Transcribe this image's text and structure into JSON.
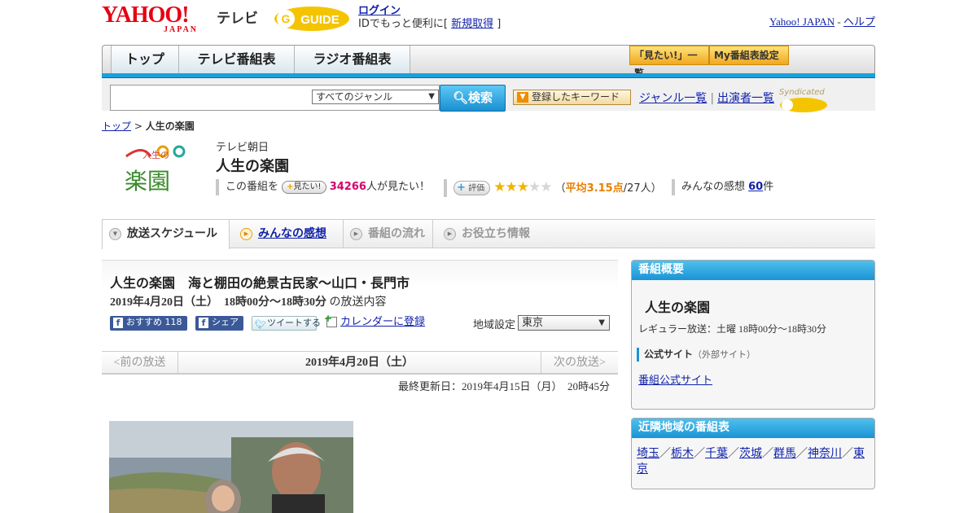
{
  "header": {
    "yahoo_logo": "YAHOO!",
    "yahoo_sub": "JAPAN",
    "tv_label": "テレビ",
    "gguide_logo": "GUIDE",
    "login_link": "ログイン",
    "login_desc_pre": "IDでもっと便利に[ ",
    "register_link": "新規取得",
    "login_desc_post": " ]",
    "yahoo_japan_link": "Yahoo! JAPAN",
    "sep": " - ",
    "help_link": "ヘルプ"
  },
  "nav": {
    "tabs": [
      "トップ",
      "テレビ番組表",
      "ラジオ番組表"
    ],
    "mitai_list": "「見たい!」一覧",
    "my_schedule": "My番組表設定"
  },
  "search": {
    "genre_selected": "すべてのジャンル",
    "button": "検索",
    "keyword_button": "登録したキーワード",
    "genre_list": "ジャンル一覧",
    "performer_list": "出演者一覧",
    "syndicated": "Syndicated"
  },
  "breadcrumb": {
    "top": "トップ",
    "sep": " > ",
    "current": "人生の楽園"
  },
  "program": {
    "logo_text_1": "人生の",
    "logo_text_2": "楽園",
    "station": "テレビ朝日",
    "title": "人生の楽園",
    "mitai_pre": "この番組を",
    "mitai_btn": "見たい!",
    "mitai_count": "34266",
    "mitai_post": "人が見たい！",
    "rating_btn": "評価",
    "rating_value": 3.15,
    "avg_pre": "（",
    "avg_text": "平均3.15点",
    "avg_post": "/27人）",
    "kanso_pre": "みんなの感想 ",
    "kanso_count": "60",
    "kanso_post": "件"
  },
  "subtabs": [
    "放送スケジュール",
    "みんなの感想",
    "番組の流れ",
    "お役立ち情報"
  ],
  "episode": {
    "title": "人生の楽園　海と棚田の絶景古民家～山口・長門市",
    "date_bold": "2019年4月20日（土）　18時00分～18時30分",
    "date_post": "の放送内容",
    "fb_recommend": "おすすめ 118",
    "fb_share": "シェア",
    "tweet": "ツイートする",
    "calendar": "カレンダーに登録",
    "region_label": "地域設定",
    "region_value": "東京",
    "prev": "<前の放送",
    "current_date": "2019年4月20日（土）",
    "next": "次の放送>",
    "updated": "最終更新日：2019年4月15日（月）　20時45分"
  },
  "sidebar": {
    "overview_header": "番組概要",
    "program_name": "人生の楽園",
    "regular": "レギュラー放送：土曜 18時00分～18時30分",
    "official_label": "公式サイト",
    "official_note": "（外部サイト）",
    "official_link": "番組公式サイト",
    "nearby_header": "近隣地域の番組表",
    "regions": [
      "埼玉",
      "栃木",
      "千葉",
      "茨城",
      "群馬",
      "神奈川",
      "東京"
    ],
    "region_sep": "／"
  },
  "colors": {
    "accent_blue": "#1aa0dc",
    "link": "#1122aa",
    "pink": "#d6006e",
    "star": "#f0b400",
    "yahoo_red": "#e60012"
  }
}
